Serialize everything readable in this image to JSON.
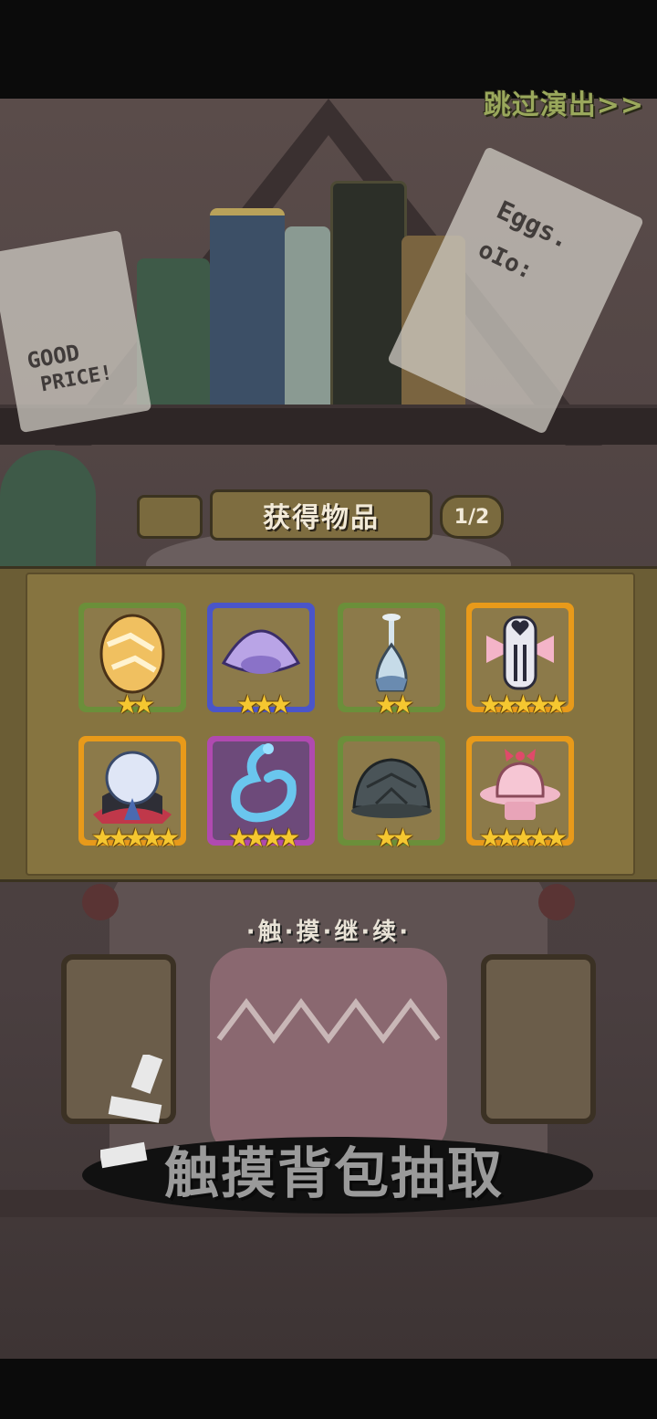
{
  "skip_button": {
    "label": "跳过演出>>"
  },
  "notes": {
    "left_sign": {
      "line1": "GOOD",
      "line2": "PRICE!"
    },
    "right_sign": {
      "line1": "Eggs.",
      "line2": "oIo:"
    }
  },
  "reward_panel": {
    "title": "获得物品",
    "page_counter": "1/2",
    "items": [
      {
        "name": "cracked-egg",
        "rarity_color": "green",
        "stars": 2,
        "stars_text": "★★"
      },
      {
        "name": "jellyfish-cap",
        "rarity_color": "blue",
        "stars": 3,
        "stars_text": "★★★"
      },
      {
        "name": "glass-flask",
        "rarity_color": "green",
        "stars": 2,
        "stars_text": "★★"
      },
      {
        "name": "heart-mask-bow",
        "rarity_color": "gold",
        "stars": 5,
        "stars_text": "★★★★★"
      },
      {
        "name": "crystal-orb-collar",
        "rarity_color": "gold",
        "stars": 5,
        "stars_text": "★★★★★"
      },
      {
        "name": "water-swirl",
        "rarity_color": "purple",
        "stars": 4,
        "stars_text": "★★★★"
      },
      {
        "name": "turtle-shell",
        "rarity_color": "green",
        "stars": 2,
        "stars_text": "★★"
      },
      {
        "name": "pink-cupcake-hat",
        "rarity_color": "gold",
        "stars": 5,
        "stars_text": "★★★★★"
      }
    ]
  },
  "touch_continue": "·触·摸·继·续·",
  "bottom_hint": "触摸背包抽取",
  "colors": {
    "green": "#6b8f3a",
    "blue": "#4a55c9",
    "gold": "#e89a1a",
    "purple": "#b04ab0",
    "star": "#f5c730"
  }
}
